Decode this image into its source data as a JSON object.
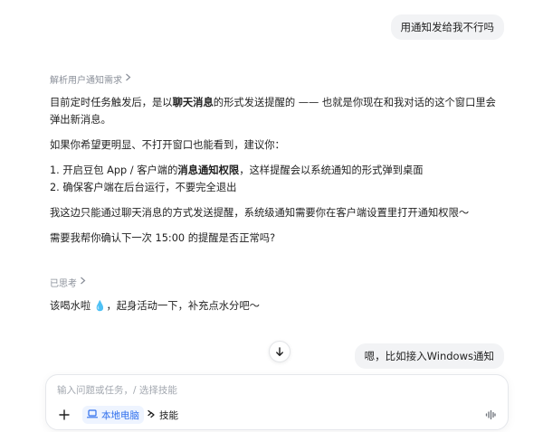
{
  "messages": {
    "user_1": "用通知发给我不行吗",
    "thinking_1_label": "解析用户通知需求",
    "answer_1": {
      "p1_pre": "目前定时任务触发后，是以",
      "p1_bold": "聊天消息",
      "p1_post": "的形式发送提醒的 —— 也就是你现在和我对话的这个窗口里会弹出新消息。",
      "p2": "如果你希望更明显、不打开窗口也能看到，建议你：",
      "step1_pre": "1. 开启豆包 App / 客户端的",
      "step1_bold": "消息通知权限",
      "step1_post": "，这样提醒会以系统通知的形式弹到桌面",
      "step2": "2. 确保客户端在后台运行，不要完全退出",
      "p3": "我这边只能通过聊天消息的方式发送提醒，系统级通知需要你在客户端设置里打开通知权限～",
      "p4": "需要我帮你确认下一次 15:00 的提醒是否正常吗?"
    },
    "thinking_2_label": "已思考",
    "answer_2_pre": "该喝水啦 ",
    "answer_2_emoji": "💧",
    "answer_2_post": "，起身活动一下，补充点水分吧～",
    "user_2": "嗯，比如接入Windows通知"
  },
  "composer": {
    "placeholder": "输入问题或任务，/ 选择技能",
    "value": "",
    "local_pc_label": "本地电脑",
    "skills_label": "技能"
  },
  "icons": {
    "chevron": "chevron-right-icon",
    "scroll": "arrow-down-icon",
    "plus": "plus-icon",
    "laptop": "laptop-icon",
    "skills": "skills-icon",
    "voice": "voice-wave-icon"
  },
  "colors": {
    "accent": "#2f6fed",
    "bubble_bg": "#f2f3f5",
    "muted_text": "#8a8f99"
  }
}
